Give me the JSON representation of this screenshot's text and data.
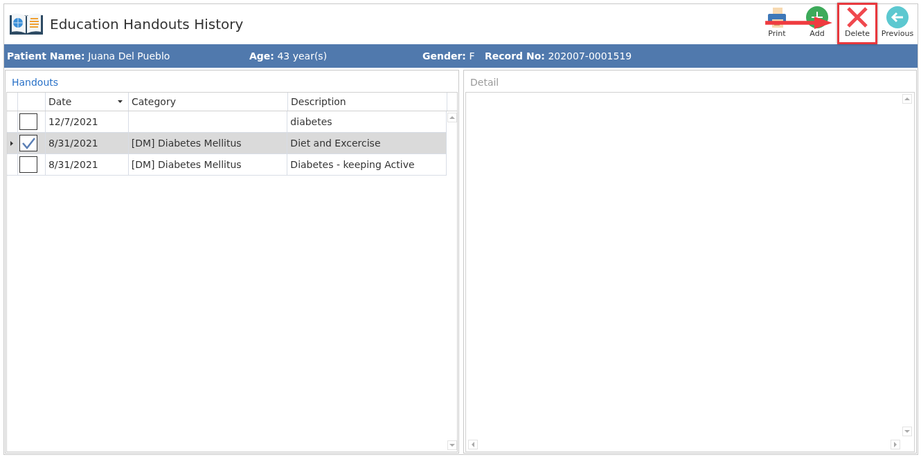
{
  "window": {
    "title": "Education Handouts History"
  },
  "toolbar": [
    {
      "kind": "print",
      "label": "Print",
      "highlighted": false
    },
    {
      "kind": "add",
      "label": "Add",
      "highlighted": false
    },
    {
      "kind": "delete",
      "label": "Delete",
      "highlighted": true
    },
    {
      "kind": "previous",
      "label": "Previous",
      "highlighted": false
    }
  ],
  "patient_bar": [
    {
      "label": "Patient Name:",
      "value": "Juana Del Pueblo"
    },
    {
      "label": "Age:",
      "value": "43 year(s)"
    },
    {
      "label": "Gender:",
      "value": "F"
    },
    {
      "label": "Record No:",
      "value": "202007-0001519"
    }
  ],
  "handouts": {
    "title": "Handouts",
    "columns": [
      {
        "label": "Date",
        "sorted": true
      },
      {
        "label": "Category",
        "sorted": false
      },
      {
        "label": "Description",
        "sorted": false
      }
    ],
    "rows": [
      {
        "checked": false,
        "selected": false,
        "cells": [
          "12/7/2021",
          "",
          "diabetes"
        ]
      },
      {
        "checked": true,
        "selected": true,
        "cells": [
          "8/31/2021",
          "[DM] Diabetes Mellitus",
          "Diet and Excercise"
        ]
      },
      {
        "checked": false,
        "selected": false,
        "cells": [
          "8/31/2021",
          "[DM] Diabetes Mellitus",
          "Diabetes - keeping Active"
        ]
      }
    ]
  },
  "detail": {
    "title": "Detail"
  }
}
